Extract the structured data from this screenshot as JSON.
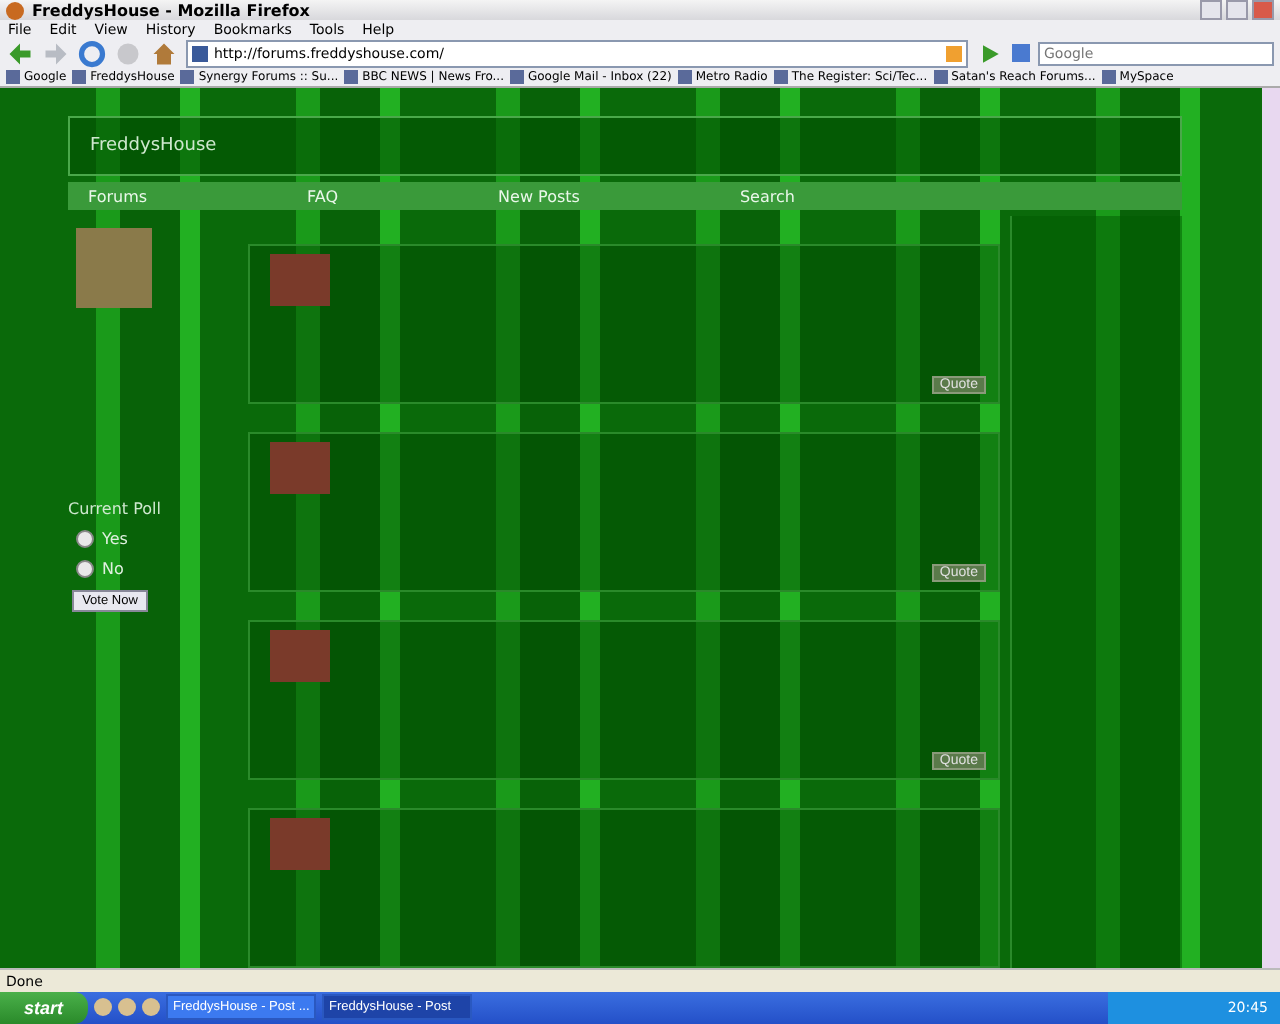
{
  "window": {
    "title": "FreddysHouse - Mozilla Firefox"
  },
  "menu": [
    "File",
    "Edit",
    "View",
    "History",
    "Bookmarks",
    "Tools",
    "Help"
  ],
  "address": {
    "url": "http://forums.freddyshouse.com/"
  },
  "search": {
    "placeholder": "Google"
  },
  "bookmarks": [
    {
      "label": "Google"
    },
    {
      "label": "FreddysHouse"
    },
    {
      "label": "Synergy Forums :: Su..."
    },
    {
      "label": "BBC NEWS | News Fro..."
    },
    {
      "label": "Google Mail - Inbox (22)"
    },
    {
      "label": "Metro Radio"
    },
    {
      "label": "The Register: Sci/Tec..."
    },
    {
      "label": "Satan's Reach Forums..."
    },
    {
      "label": "MySpace"
    }
  ],
  "forum": {
    "logo": "FreddysHouse",
    "nav": [
      "Forums",
      "FAQ",
      "New Posts",
      "Search"
    ],
    "sidebar": {
      "poll_title": "Current Poll",
      "options": [
        {
          "label": "Yes",
          "selected": false
        },
        {
          "label": "No",
          "selected": false
        }
      ],
      "vote_button": "Vote Now"
    },
    "posts": [
      {
        "kind": "reply",
        "quote_button": "Quote"
      },
      {
        "kind": "reply",
        "quote_button": "Quote"
      },
      {
        "kind": "reply",
        "quote_button": "Quote"
      },
      {
        "kind": "reply"
      }
    ]
  },
  "status_bar": {
    "text": "Done"
  },
  "taskbar": {
    "start": "start",
    "tasks": [
      {
        "label": "FreddysHouse - Post ...",
        "selected": false
      },
      {
        "label": "FreddysHouse - Post",
        "selected": true
      }
    ],
    "clock": "20:45"
  }
}
